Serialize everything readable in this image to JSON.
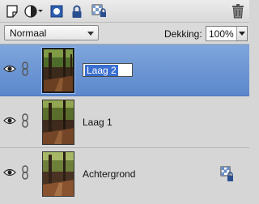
{
  "toolbar": {
    "buttons": [
      {
        "name": "new-layer-icon"
      },
      {
        "name": "adjustment-layer-icon"
      },
      {
        "name": "layer-mask-icon"
      },
      {
        "name": "lock-all-icon"
      },
      {
        "name": "lock-transparency-icon"
      },
      {
        "name": "delete-layer-icon"
      }
    ]
  },
  "options": {
    "blend_mode": "Normaal",
    "opacity_label": "Dekking:",
    "opacity_value": "100%"
  },
  "layers": [
    {
      "name": "Laag 2",
      "visible": true,
      "selected": true,
      "editing": true
    },
    {
      "name": "Laag 1",
      "visible": true,
      "selected": false
    },
    {
      "name": "Achtergrond",
      "visible": true,
      "selected": false,
      "locked": true
    }
  ],
  "colors": {
    "selection": "#5b87cb",
    "panel": "#d6d6d6"
  }
}
